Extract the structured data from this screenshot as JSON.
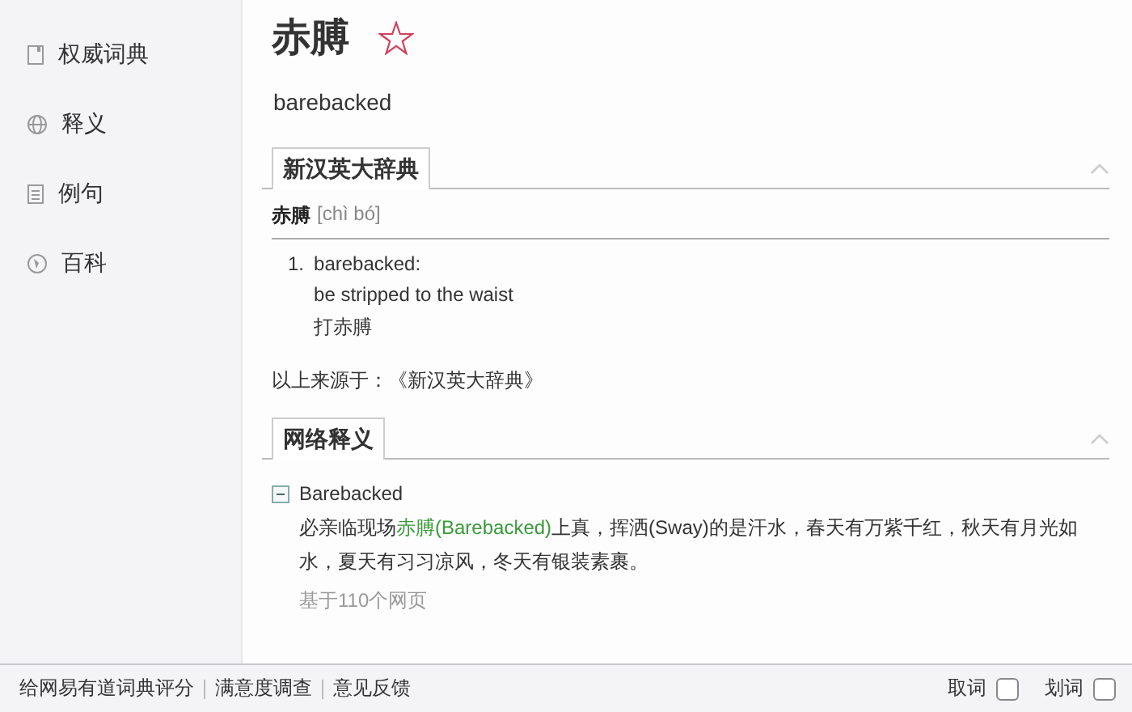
{
  "sidebar": {
    "items": [
      {
        "label": "权威词典",
        "selected": false
      },
      {
        "label": "释义",
        "selected": false
      },
      {
        "label": "例句",
        "selected": false
      },
      {
        "label": "百科",
        "selected": false
      }
    ]
  },
  "headword": {
    "text": "赤膊",
    "starred": false
  },
  "translation": "barebacked",
  "sections": [
    {
      "kind": "dictionary",
      "tab": "新汉英大辞典",
      "entry": "赤膊",
      "pinyin": "[chì bó]",
      "senses": [
        {
          "number": "1.",
          "lines": [
            "barebacked:",
            "be stripped to the waist",
            "打赤膊"
          ]
        }
      ],
      "source": "以上来源于：《新汉英大辞典》"
    },
    {
      "kind": "web",
      "tab": "网络释义",
      "items": [
        {
          "term": "Barebacked",
          "expanded": true,
          "example": [
            {
              "text": "必亲临现场",
              "highlight": false
            },
            {
              "text": "赤膊(Barebacked)",
              "highlight": true
            },
            {
              "text": "上真，挥洒(Sway)的是汗水，春天有万紫千红，秋天有月光如水，夏天有习习凉风，冬天有银装素裹。",
              "highlight": false
            }
          ],
          "note": "基于110个网页"
        }
      ]
    }
  ],
  "footer": {
    "links": [
      "给网易有道词典评分",
      "满意度调查",
      "意见反馈"
    ],
    "toggles": [
      {
        "label": "取词",
        "checked": false
      },
      {
        "label": "划词",
        "checked": false
      }
    ]
  }
}
